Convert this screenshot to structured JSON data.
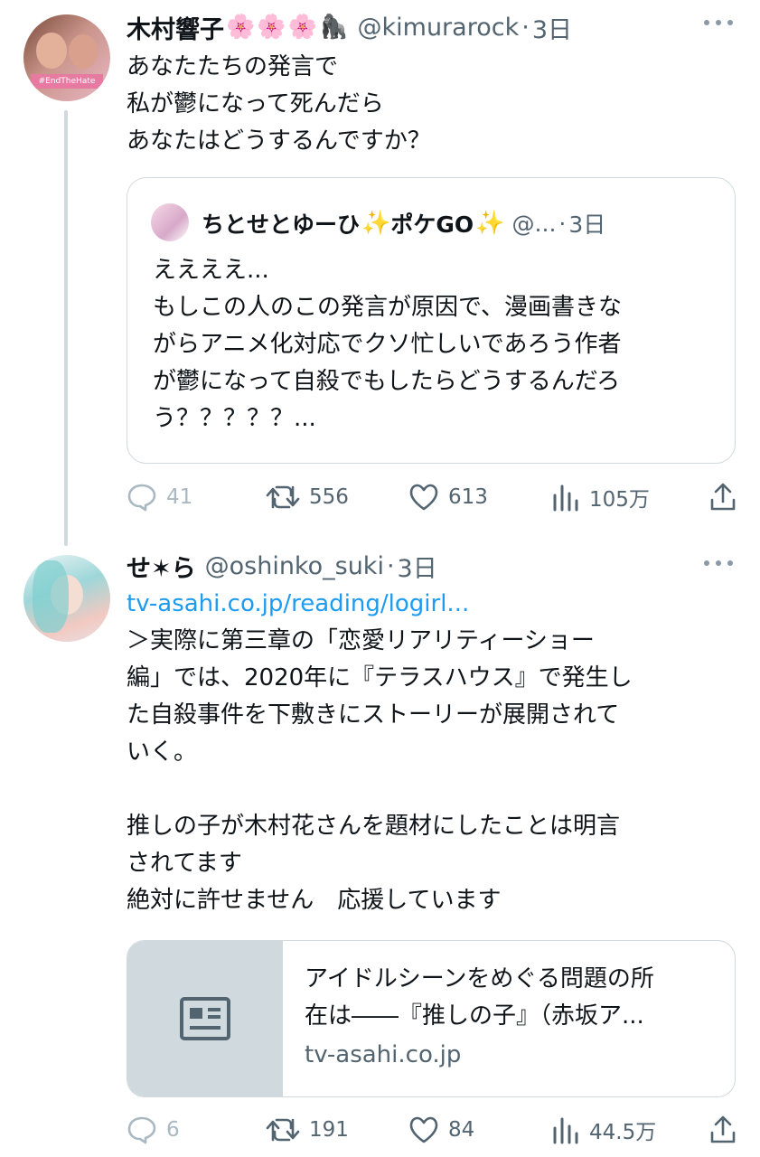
{
  "tweets": [
    {
      "display_name": "木村響子",
      "name_emojis": [
        "🌸",
        "🌸",
        "🌸",
        "🦍"
      ],
      "avatar_badge": "#EndTheHate",
      "handle": "@kimurarock",
      "dot": "·",
      "time": "3日",
      "text_lines": [
        "あなたたちの発言で",
        "私が鬱になって死んだら",
        "あなたはどうするんですか？"
      ],
      "quote": {
        "display_name": "ちとせとゆーひ",
        "name_emojis": [
          "✨",
          "✨"
        ],
        "name_middle": "ポケGO",
        "handle": "@...",
        "dot": "·",
        "time": "3日",
        "text_lines": [
          "ええええ...",
          "もしこの人のこの発言が原因で、漫画書きな",
          "がらアニメ化対応でクソ忙しいであろう作者",
          "が鬱になって自殺でもしたらどうするんだろ",
          "う？？？？？..."
        ]
      },
      "stats": {
        "replies": "41",
        "retweets": "556",
        "likes": "613",
        "views": "105万"
      }
    },
    {
      "display_name": "せ✶ら",
      "handle": "@oshinko_suki",
      "dot": "·",
      "time": "3日",
      "link": "tv-asahi.co.jp/reading/logirl...",
      "text_lines": [
        "＞実際に第三章の「恋愛リアリティーショー",
        "編」では、2020年に『テラスハウス』で発生し",
        "た自殺事件を下敷きにストーリーが展開されて",
        "いく。",
        "",
        "推しの子が木村花さんを題材にしたことは明言",
        "されてます",
        "絶対に許せません　応援しています"
      ],
      "card": {
        "title_lines": [
          "アイドルシーンをめぐる問題の所",
          "在は――『推しの子』（赤坂ア..."
        ],
        "domain": "tv-asahi.co.jp"
      },
      "stats": {
        "replies": "6",
        "retweets": "191",
        "likes": "84",
        "views": "44.5万"
      }
    }
  ],
  "icons": [
    "reply-icon",
    "retweet-icon",
    "like-icon",
    "views-icon",
    "share-icon",
    "more-icon",
    "article-icon"
  ],
  "colors": {
    "text": "#0f1419",
    "secondary": "#536471",
    "link": "#1d9bf0",
    "border": "#cfd9de"
  }
}
